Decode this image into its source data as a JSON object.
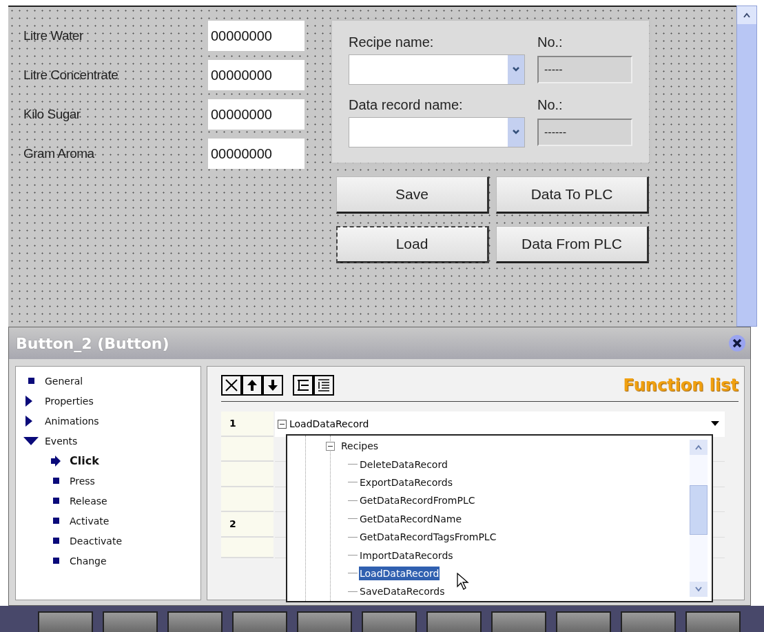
{
  "canvas": {
    "fields": [
      {
        "label": "Litre Water",
        "value": "00000000"
      },
      {
        "label": "Litre Concentrate",
        "value": "00000000"
      },
      {
        "label": "Kilo Sugar",
        "value": "00000000"
      },
      {
        "label": "Gram Aroma",
        "value": "00000000"
      }
    ],
    "recipe_panel": {
      "recipe_label": "Recipe name:",
      "recipe_no_label": "No.:",
      "recipe_no": "-----",
      "record_label": "Data record name:",
      "record_no_label": "No.:",
      "record_no": "------"
    },
    "buttons": [
      {
        "label": "Save",
        "selected": false
      },
      {
        "label": "Data To PLC",
        "selected": false
      },
      {
        "label": "Load",
        "selected": true
      },
      {
        "label": "Data From PLC",
        "selected": false
      }
    ]
  },
  "inspector": {
    "title": "Button_2 (Button)",
    "nav": [
      {
        "label": "General",
        "selected": false
      },
      {
        "label": "Properties",
        "selected": false,
        "expanded": false
      },
      {
        "label": "Animations",
        "selected": false,
        "expanded": false
      },
      {
        "label": "Events",
        "selected": false,
        "expanded": true,
        "children": [
          {
            "label": "Click",
            "selected": true
          },
          {
            "label": "Press",
            "selected": false
          },
          {
            "label": "Release",
            "selected": false
          },
          {
            "label": "Activate",
            "selected": false
          },
          {
            "label": "Deactivate",
            "selected": false
          },
          {
            "label": "Change",
            "selected": false
          }
        ]
      }
    ],
    "function_list": {
      "title": "Function list",
      "rows": [
        {
          "number": "1",
          "function": "LoadDataRecord",
          "expanded": true
        },
        {
          "number": "2"
        }
      ]
    },
    "function_dropdown": {
      "tree": [
        {
          "label": "Recipes",
          "expanded": true,
          "children": [
            {
              "label": "DeleteDataRecord",
              "selected": false
            },
            {
              "label": "ExportDataRecords",
              "selected": false
            },
            {
              "label": "GetDataRecordFromPLC",
              "selected": false
            },
            {
              "label": "GetDataRecordName",
              "selected": false
            },
            {
              "label": "GetDataRecordTagsFromPLC",
              "selected": false
            },
            {
              "label": "ImportDataRecords",
              "selected": false
            },
            {
              "label": "LoadDataRecord",
              "selected": true
            },
            {
              "label": "SaveDataRecords",
              "selected": false
            }
          ]
        }
      ]
    }
  }
}
